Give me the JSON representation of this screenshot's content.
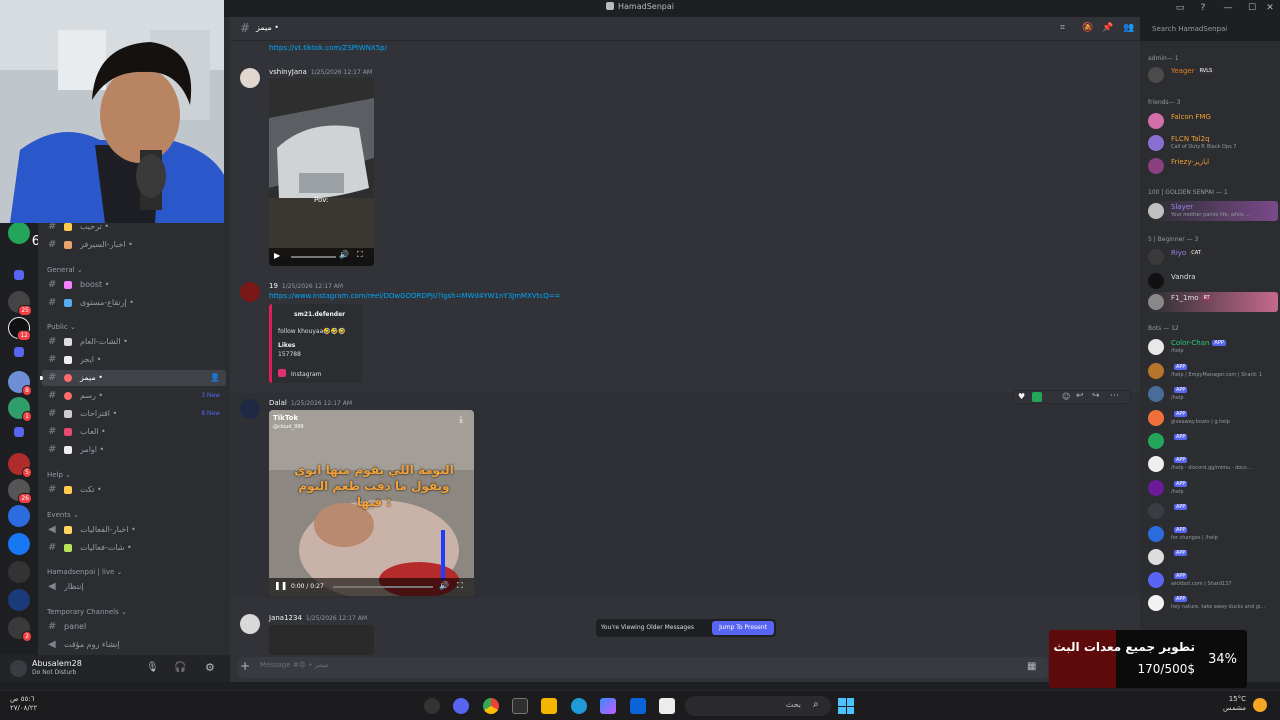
{
  "window": {
    "title": "HamadSenpai",
    "controls": [
      "inbox-icon",
      "help-icon",
      "minimize-icon",
      "maximize-icon",
      "close-icon"
    ]
  },
  "server_rail": {
    "badges": [
      "6",
      "25",
      "12",
      "8",
      "1",
      "5",
      "26",
      "2"
    ]
  },
  "channels": {
    "top_items": [
      {
        "name": "ترحيب •",
        "emoji_color": "#ffcc4d"
      },
      {
        "name": "اخبار-السيرفر •",
        "emoji_color": "#e8a36b"
      }
    ],
    "categories": [
      {
        "name": "General",
        "items": [
          {
            "name": "boost •",
            "emoji_color": "#f47fff"
          },
          {
            "name": "إرتقاع-مستوى •",
            "emoji_color": "#55acee"
          }
        ]
      },
      {
        "name": "Public",
        "items": [
          {
            "name": "الشات-العام •",
            "emoji_color": "#dddddd"
          },
          {
            "name": "ايجر •",
            "emoji_color": "#eeeeee"
          },
          {
            "name": "ميمز •",
            "emoji_color": "#ff6b6b",
            "active": true
          },
          {
            "name": "رسم •",
            "emoji_color": "#ff6b6b",
            "new": "3 New"
          },
          {
            "name": "اقتراحات •",
            "emoji_color": "#cccccc",
            "new": "8 New"
          },
          {
            "name": "العاب •",
            "emoji_color": "#e64a6e"
          },
          {
            "name": "اوامر •",
            "emoji_color": "#eeeeee"
          }
        ]
      },
      {
        "name": "Help",
        "items": [
          {
            "name": "تكت •",
            "emoji_color": "#ffcc4d"
          }
        ]
      },
      {
        "name": "Events",
        "items": [
          {
            "name": "اخبار-الفعاليات •",
            "emoji_color": "#ffd35c"
          },
          {
            "name": "شات-فعاليات •",
            "emoji_color": "#b9e25b"
          }
        ]
      },
      {
        "name": "Hamadsenpai | live",
        "items": [
          {
            "name": "إنتظار",
            "emoji_color": ""
          }
        ]
      },
      {
        "name": "Temporary Channels",
        "items": [
          {
            "name": "panel",
            "emoji_color": ""
          },
          {
            "name": "إنشاء روم مؤقت",
            "emoji_color": ""
          }
        ]
      }
    ]
  },
  "user_panel": {
    "name": "Abusalem28",
    "status": "Do Not Disturb"
  },
  "chat": {
    "channel_title": "ميمز •",
    "search_placeholder": "Search HamadSenpai",
    "messages": [
      {
        "link": "https://vt.tiktok.com/ZSPtWNX5p/"
      },
      {
        "author": "vshinyJana",
        "time": "1/25/2026 12:17 AM",
        "video_caption": "Pov:"
      },
      {
        "author": "19",
        "time": "1/25/2026 12:17 AM",
        "link": "https://www.instagram.com/reel/DOwGOORDPjI/?igsh=MWd4YW1nY3JmMXVtcQ==",
        "embed": {
          "title": "sm21.defender",
          "body": "follow khouyaa🤣🤣🤣",
          "likes_label": "Likes",
          "likes_value": "157788",
          "footer": "Instagram"
        }
      },
      {
        "author": "Dalal",
        "time": "1/25/2026 12:17 AM",
        "video_brand": "TikTok",
        "video_handle": "@cloud_999",
        "video_text": "النومة اللي يقوم منها ابوي ويقول ما ذقت طعم النوم فيها :",
        "video_time": "0:00 / 0:27"
      },
      {
        "author": "Jana1234",
        "time": "1/25/2026 12:17 AM"
      }
    ],
    "older_notice": "You're Viewing Older Messages",
    "jump_label": "Jump To Present",
    "composer_placeholder": "Message #😡 • ميمز"
  },
  "members": {
    "groups": [
      {
        "title": "admin— 1",
        "members": [
          {
            "name": "Yeager",
            "tag": "RVLS",
            "color": "#e67e22"
          }
        ]
      },
      {
        "title": "friends— 3",
        "members": [
          {
            "name": "Falcon FMG",
            "color": "#f0a030"
          },
          {
            "name": "FLCN Tal2q",
            "sub": "Call of Duty® Black Ops 7",
            "color": "#f0a030"
          },
          {
            "name": "Friezy-ايازيز",
            "color": "#f0a030"
          }
        ]
      },
      {
        "title": "100 | GOLDEN SENPAI — 1",
        "members": [
          {
            "name": "Slayer",
            "sub": "Your mother paints life, while ...",
            "color": "#9b84ec"
          }
        ]
      },
      {
        "title": "5 | Beginner — 3",
        "members": [
          {
            "name": "Riyo",
            "tag": "CAT",
            "color": "#9b84ec"
          },
          {
            "name": "Vandra",
            "color": "#dbdee1"
          },
          {
            "name": "F1_1mo",
            "tag": "RT",
            "color": "#dbdee1"
          }
        ]
      },
      {
        "title": "Bots — 12",
        "members": [
          {
            "name": "Color-Chan",
            "sub": "/help",
            "tag": "APP",
            "color": "#2ecc71"
          },
          {
            "name": "",
            "sub": "/help | EmpyManager.com | Shard: 1",
            "tag": "APP",
            "color": "#dbdee1"
          },
          {
            "name": "",
            "sub": "/help",
            "tag": "APP",
            "color": "#dbdee1"
          },
          {
            "name": "",
            "sub": "giveaway.boats | g.help",
            "tag": "APP",
            "color": "#dbdee1"
          },
          {
            "name": "",
            "sub": "",
            "tag": "APP",
            "color": "#dbdee1"
          },
          {
            "name": "",
            "sub": "/help · discord.gg/mimu · docs...",
            "tag": "APP",
            "color": "#dbdee1"
          },
          {
            "name": "",
            "sub": "/help",
            "tag": "APP",
            "color": "#dbdee1"
          },
          {
            "name": "",
            "sub": "",
            "tag": "APP",
            "color": "#dbdee1"
          },
          {
            "name": "",
            "sub": "for changes | /help",
            "tag": "APP",
            "color": "#dbdee1"
          },
          {
            "name": "",
            "sub": "",
            "tag": "APP",
            "color": "#dbdee1"
          },
          {
            "name": "",
            "sub": "wickbot.com | Shard137",
            "tag": "APP",
            "color": "#dbdee1"
          },
          {
            "name": "",
            "sub": "hey nature, take away ducks and gi...",
            "tag": "APP",
            "color": "#dbdee1"
          }
        ]
      }
    ]
  },
  "donation": {
    "title": "تطوير جميع معدات البث",
    "amount": "170/500$",
    "percent": "34%",
    "progress": 0.34
  },
  "taskbar": {
    "search": "بحث",
    "time": "٥٥:٦ ص",
    "date": "٢٧/٠٨/٢٢",
    "temp": "15°C",
    "weather": "مشمس"
  }
}
